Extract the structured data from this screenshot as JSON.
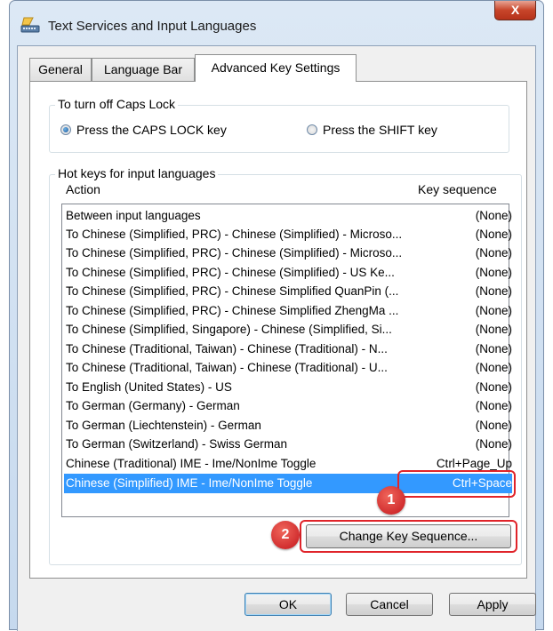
{
  "window": {
    "title": "Text Services and Input Languages",
    "close_label": "X"
  },
  "tabs": [
    {
      "label": "General",
      "active": false
    },
    {
      "label": "Language Bar",
      "active": false
    },
    {
      "label": "Advanced Key Settings",
      "active": true
    }
  ],
  "caps_lock": {
    "group_label": "To turn off Caps Lock",
    "options": [
      {
        "label": "Press the CAPS LOCK key",
        "checked": true
      },
      {
        "label": "Press the SHIFT key",
        "checked": false
      }
    ]
  },
  "hot_keys": {
    "group_label": "Hot keys for input languages",
    "col_action": "Action",
    "col_key": "Key sequence",
    "rows": [
      {
        "action": "Between input languages",
        "key": "(None)"
      },
      {
        "action": "To Chinese (Simplified, PRC) - Chinese (Simplified) - Microso...",
        "key": "(None)"
      },
      {
        "action": "To Chinese (Simplified, PRC) - Chinese (Simplified) - Microso...",
        "key": "(None)"
      },
      {
        "action": "To Chinese (Simplified, PRC) - Chinese (Simplified) - US Ke...",
        "key": "(None)"
      },
      {
        "action": "To Chinese (Simplified, PRC) - Chinese Simplified QuanPin (...",
        "key": "(None)"
      },
      {
        "action": "To Chinese (Simplified, PRC) - Chinese Simplified ZhengMa ...",
        "key": "(None)"
      },
      {
        "action": "To Chinese (Simplified, Singapore) - Chinese (Simplified, Si...",
        "key": "(None)"
      },
      {
        "action": "To Chinese (Traditional, Taiwan) - Chinese (Traditional) - N...",
        "key": "(None)"
      },
      {
        "action": "To Chinese (Traditional, Taiwan) - Chinese (Traditional) - U...",
        "key": "(None)"
      },
      {
        "action": "To English (United States) - US",
        "key": "(None)"
      },
      {
        "action": "To German (Germany) - German",
        "key": "(None)"
      },
      {
        "action": "To German (Liechtenstein) - German",
        "key": "(None)"
      },
      {
        "action": "To German (Switzerland) - Swiss German",
        "key": "(None)"
      },
      {
        "action": "Chinese (Traditional) IME - Ime/NonIme Toggle",
        "key": "Ctrl+Page_Up"
      },
      {
        "action": "Chinese (Simplified) IME - Ime/NonIme Toggle",
        "key": "Ctrl+Space",
        "selected": true
      }
    ],
    "change_button": "Change Key Sequence..."
  },
  "callouts": {
    "step1": "1",
    "step2": "2",
    "color": "#e0242a"
  },
  "buttons": {
    "ok": "OK",
    "cancel": "Cancel",
    "apply": "Apply"
  }
}
